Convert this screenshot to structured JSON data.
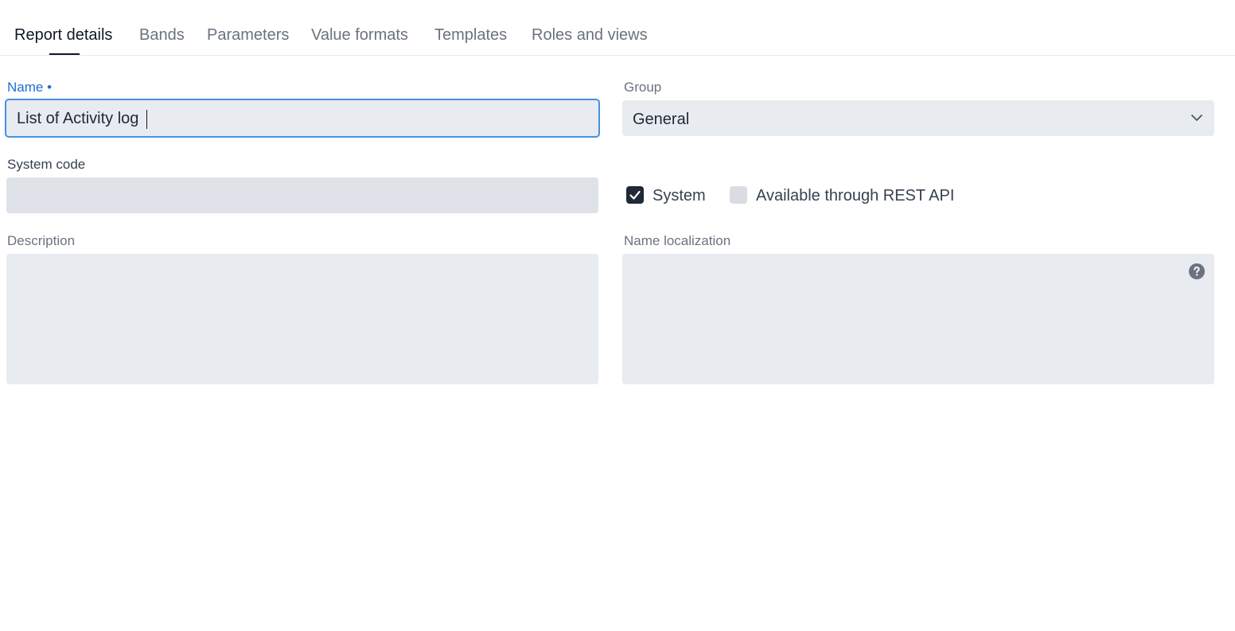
{
  "tabs": [
    {
      "label": "Report details",
      "active": true
    },
    {
      "label": "Bands",
      "active": false
    },
    {
      "label": "Parameters",
      "active": false
    },
    {
      "label": "Value formats",
      "active": false
    },
    {
      "label": "Templates",
      "active": false
    },
    {
      "label": "Roles and views",
      "active": false
    }
  ],
  "form": {
    "name": {
      "label": "Name •",
      "value": "List of Activity log"
    },
    "group": {
      "label": "Group",
      "value": "General"
    },
    "system_code": {
      "label": "System code",
      "value": ""
    },
    "system_checkbox": {
      "label": "System",
      "checked": true
    },
    "rest_checkbox": {
      "label": "Available through REST API",
      "checked": false
    },
    "description": {
      "label": "Description",
      "value": ""
    },
    "name_localization": {
      "label": "Name localization",
      "value": ""
    }
  },
  "icons": {
    "group_dropdown": "chevron-down-icon",
    "localization_help": "help-circle-icon",
    "system_check": "check-icon"
  },
  "colors": {
    "accent": "#1e6fd1",
    "focus_border": "#4a90e2",
    "field_bg": "#e8ebf0"
  }
}
